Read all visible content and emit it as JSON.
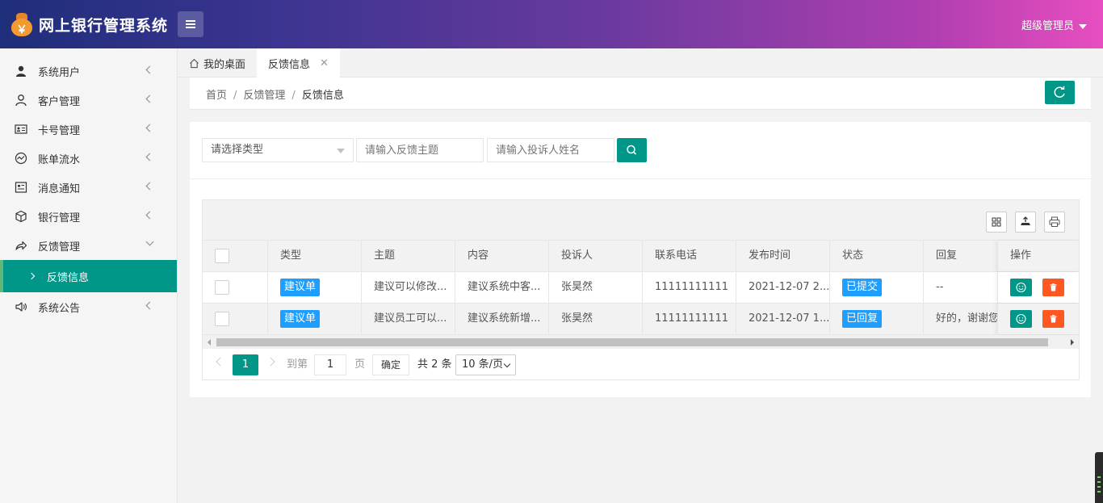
{
  "header": {
    "app_title": "网上银行管理系统",
    "user_label": "超级管理员",
    "logo_glyph": "￥",
    "brand_colors": [
      "#1f2e7a",
      "#e84ec0"
    ]
  },
  "sidebar": {
    "items": [
      {
        "label": "系统用户",
        "icon": "user-solid-icon"
      },
      {
        "label": "客户管理",
        "icon": "user-outline-icon"
      },
      {
        "label": "卡号管理",
        "icon": "id-card-icon"
      },
      {
        "label": "账单流水",
        "icon": "chart-line-icon"
      },
      {
        "label": "消息通知",
        "icon": "notice-icon"
      },
      {
        "label": "银行管理",
        "icon": "cube-icon"
      },
      {
        "label": "反馈管理",
        "icon": "share-icon",
        "expanded": true,
        "children": [
          {
            "label": "反馈信息",
            "active": true
          }
        ]
      },
      {
        "label": "系统公告",
        "icon": "speaker-icon"
      }
    ]
  },
  "tabs": [
    {
      "label": "我的桌面"
    },
    {
      "label": "反馈信息",
      "active": true
    }
  ],
  "breadcrumb": {
    "home": "首页",
    "section": "反馈管理",
    "page": "反馈信息",
    "separator": "/"
  },
  "search": {
    "type_placeholder": "请选择类型",
    "subject_placeholder": "请输入反馈主题",
    "name_placeholder": "请输入投诉人姓名"
  },
  "table": {
    "columns": [
      "类型",
      "主题",
      "内容",
      "投诉人",
      "联系电话",
      "发布时间",
      "状态",
      "回复",
      "操作"
    ],
    "rows": [
      {
        "type": "建议单",
        "subject": "建议可以修改...",
        "content": "建议系统中客...",
        "complainant": "张昊然",
        "phone": "11111111111",
        "time": "2021-12-07 2...",
        "status": "已提交",
        "reply": "--"
      },
      {
        "type": "建议单",
        "subject": "建议员工可以...",
        "content": "建议系统新增...",
        "complainant": "张昊然",
        "phone": "11111111111",
        "time": "2021-12-07 1...",
        "status": "已回复",
        "reply": "好的，谢谢您..."
      }
    ]
  },
  "pager": {
    "current": "1",
    "goto_label": "到第",
    "page_input": "1",
    "page_unit": "页",
    "confirm": "确定",
    "total": "共 2 条",
    "page_size": "10 条/页"
  },
  "colors": {
    "primary": "#009688",
    "tag": "#1e9fff",
    "danger": "#ff5722"
  }
}
